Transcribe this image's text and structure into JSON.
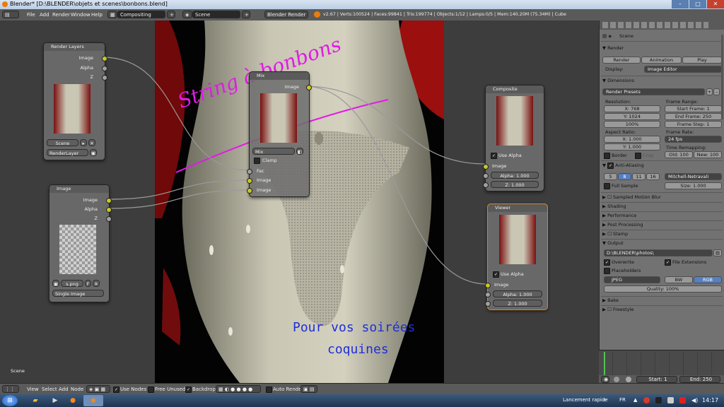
{
  "window": {
    "title": "Blender* [D:\\BLENDER\\objets et scenes\\bonbons.blend]",
    "minimize": "–",
    "maximize": "□",
    "close": "✕"
  },
  "info_header": {
    "menus": [
      "File",
      "Add",
      "Render",
      "Window",
      "Help"
    ],
    "screen_layout": "Compositing",
    "scene": "Scene",
    "engine": "Blender Render",
    "stats": "v2.67 | Verts:100524 | Faces:99841 | Tris:199774 | Objects:1/12 | Lamps:0/5 | Mem:140.20M (75.34M) | Cube"
  },
  "viewport": {
    "overlay_title": "String à bonbons",
    "caption_line1": "Pour vos soirées",
    "caption_line2": "coquines",
    "scene_label": "Scene"
  },
  "nodes": {
    "render_layers": {
      "title": "Render Layers",
      "outputs": [
        "Image",
        "Alpha",
        "Z"
      ],
      "scene": "Scene",
      "layer": "RenderLayer"
    },
    "image": {
      "title": "Image",
      "outputs": [
        "Image",
        "Alpha",
        "Z"
      ],
      "file": "s.png",
      "f_button": "F",
      "source": "Single Image"
    },
    "mix": {
      "title": "Mix",
      "output": "Image",
      "blend": "Mix",
      "clamp": "Clamp",
      "inputs": [
        "Fac",
        "Image",
        "Image"
      ]
    },
    "composite": {
      "title": "Composite",
      "use_alpha": "Use Alpha",
      "input": "Image",
      "alpha": "Alpha: 1.000",
      "z": "Z: 1.000"
    },
    "viewer": {
      "title": "Viewer",
      "use_alpha": "Use Alpha",
      "input": "Image",
      "alpha": "Alpha: 1.000",
      "z": "Z: 1.000"
    }
  },
  "properties": {
    "scene_name": "Scene",
    "render": {
      "header": "Render",
      "render_btn": "Render",
      "animation_btn": "Animation",
      "play_btn": "Play",
      "display_label": "Display:",
      "display_value": "Image Editor"
    },
    "dimensions": {
      "header": "Dimensions",
      "presets": "Render Presets",
      "resolution_label": "Resolution:",
      "res_x": "X: 768",
      "res_y": "Y: 1024",
      "res_pct": "100%",
      "frame_range_label": "Frame Range:",
      "start_frame": "Start Frame: 1",
      "end_frame": "End Frame: 250",
      "frame_step": "Frame Step: 1",
      "aspect_label": "Aspect Ratio:",
      "aspect_x": "X: 1.000",
      "aspect_y": "Y: 1.000",
      "frame_rate_label": "Frame Rate:",
      "fps": "24 fps",
      "time_remap_label": "Time Remapping:",
      "old": "Old: 100",
      "new": "New: 100",
      "border": "Border",
      "crop": "Crop"
    },
    "anti_aliasing": {
      "header": "Anti-Aliasing",
      "samples": [
        "5",
        "8",
        "11",
        "16"
      ],
      "filter": "Mitchell-Netravali",
      "full_sample": "Full Sample",
      "size": "Size: 1.000"
    },
    "collapsed_panels": [
      "Sampled Motion Blur",
      "Shading",
      "Performance",
      "Post Processing",
      "Stamp"
    ],
    "output": {
      "header": "Output",
      "path": "D:\\BLENDER\\photos\\",
      "overwrite": "Overwrite",
      "file_extensions": "File Extensions",
      "placeholders": "Placeholders",
      "format": "JPEG",
      "bw": "BW",
      "rgb": "RGB",
      "quality": "Quality: 100%"
    },
    "bake": "Bake",
    "freestyle": "Freestyle"
  },
  "timeline": {
    "start": "Start: 1",
    "end": "End: 250"
  },
  "bottom_header": {
    "menus": [
      "View",
      "Select",
      "Add",
      "Node"
    ],
    "use_nodes": "Use Nodes",
    "free_unused": "Free Unused",
    "backdrop": "Backdrop",
    "auto_render": "Auto Render"
  },
  "taskbar": {
    "quick_launch": "Lancement rapide",
    "lang": "FR",
    "time": "14:17"
  }
}
